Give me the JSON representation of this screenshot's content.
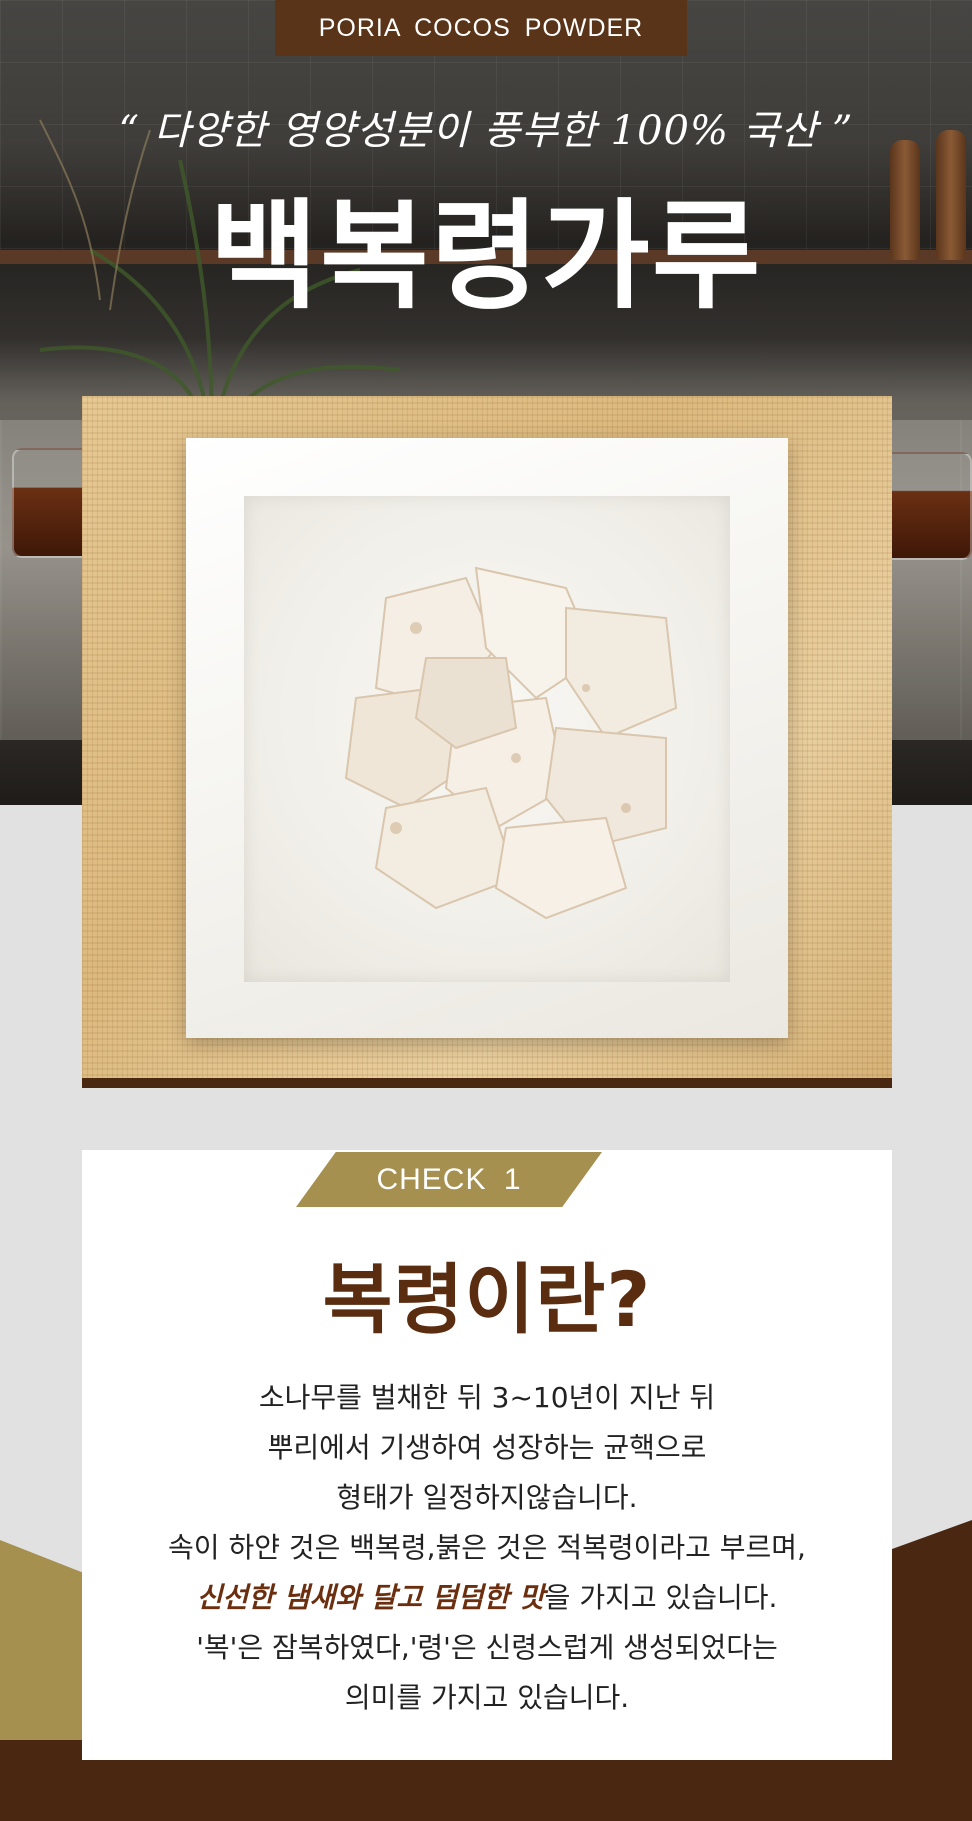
{
  "hero": {
    "tag": "PORIA COCOS POWDER",
    "subtitle": "“ 다양한 영양성분이 풍부한 100% 국산 ”",
    "title": "백복령가루"
  },
  "product_image": {
    "alt": "흰 접시에 담긴 백복령 조각"
  },
  "check": {
    "badge": "CHECK 1",
    "title": "복령이란?",
    "lines": [
      "소나무를 벌채한 뒤 3~10년이 지난 뒤",
      "뿌리에서 기생하여 성장하는 균핵으로",
      "형태가 일정하지않습니다.",
      "속이 하얀 것은 백복령,붉은 것은 적복령이라고 부르며,"
    ],
    "highlight": "신선한 냄새와 달고 덤덤한 맛",
    "highlight_suffix": "을 가지고 있습니다.",
    "lines_after": [
      "'복'은 잠복하였다,'령'은 신령스럽게 생성되었다는",
      "의미를 가지고 있습니다."
    ]
  },
  "colors": {
    "brown_dark": "#4a2710",
    "brown_tag": "#5a3418",
    "gold": "#a6904f",
    "title_brown": "#5a2c10",
    "highlight_brown": "#6b2f0f",
    "gray_bg": "#e1e1e1"
  }
}
